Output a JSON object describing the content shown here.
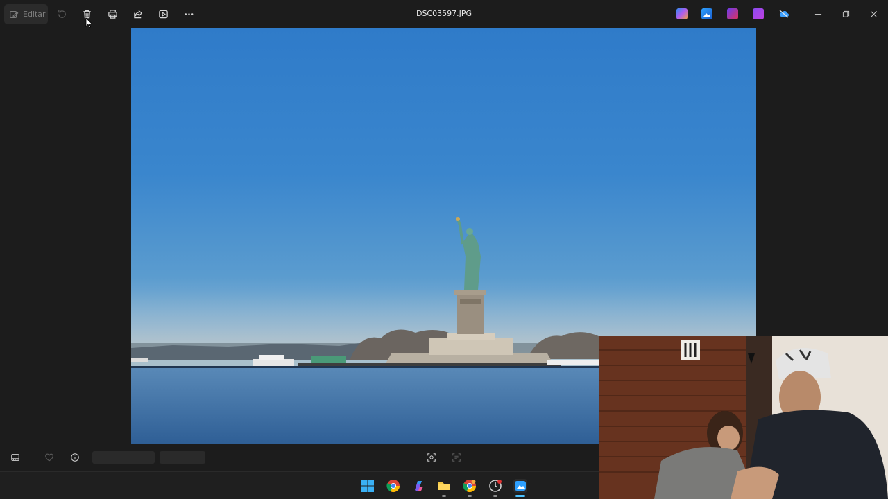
{
  "window": {
    "title": "DSC03597.JPG"
  },
  "toolbar": {
    "edit_label": "Editar",
    "icons": [
      "edit-icon",
      "rotate-icon",
      "delete-icon",
      "print-icon",
      "share-icon",
      "slideshow-icon",
      "more-icon"
    ]
  },
  "title_bar_apps": [
    "copilot-icon",
    "photos-app-icon",
    "clipchamp-icon",
    "designer-icon",
    "onedrive-icon"
  ],
  "window_controls": [
    "minimize-icon",
    "restore-icon",
    "close-icon"
  ],
  "bottom_bar": {
    "icons": [
      "filmstrip-icon",
      "favorite-icon",
      "info-icon",
      "visual-search-icon",
      "text-scan-icon"
    ]
  },
  "taskbar": {
    "apps": [
      "windows-start-icon",
      "chrome-icon",
      "copilot-icon",
      "file-explorer-icon",
      "chrome-profile-icon",
      "clock-app-icon",
      "photos-icon"
    ]
  },
  "colors": {
    "background": "#1c1c1c",
    "accent": "#4cc2ff"
  }
}
